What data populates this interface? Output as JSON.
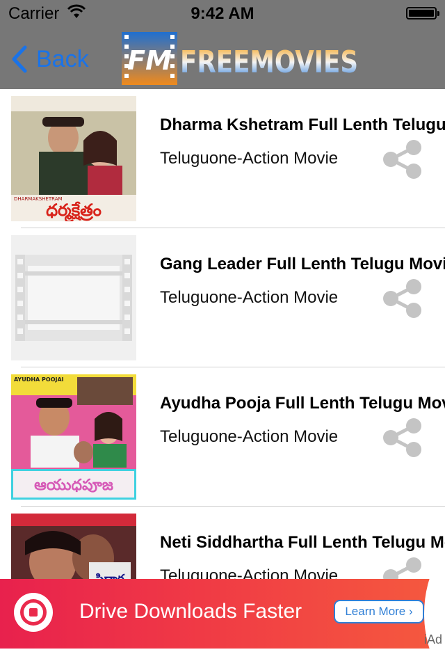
{
  "status_bar": {
    "carrier": "Carrier",
    "time": "9:42 AM"
  },
  "nav": {
    "back_label": "Back",
    "logo_badge": "FM",
    "logo_text": "FREEMOVIES"
  },
  "movies": [
    {
      "title": "Dharma Kshetram Full Lenth Telugu Movie",
      "subtitle": "Teluguone-Action Movie",
      "poster_caption": "DHARMAKSHETRAM",
      "poster_title": "ధర్మక్షేత్రం"
    },
    {
      "title": "Gang Leader Full Lenth Telugu Movie",
      "subtitle": "Teluguone-Action Movie"
    },
    {
      "title": "Ayudha Pooja Full Lenth Telugu Movie",
      "subtitle": "Teluguone-Action Movie",
      "poster_caption": "AYUDHA POOJAI",
      "poster_title": "ఆయుధపూజ"
    },
    {
      "title": "Neti Siddhartha Full Lenth Telugu Movie",
      "subtitle": "Teluguone-Action Movie",
      "poster_title": "సిద్ధార్థ"
    }
  ],
  "ad": {
    "text": "Drive Downloads Faster",
    "button_label": "Learn More ›",
    "label": "iAd"
  },
  "colors": {
    "nav_background": "#777777",
    "back_blue": "#1a73e8",
    "share_gray": "#c4c4c4",
    "ad_red": "#e8214d",
    "learn_more_blue": "#2f7fd6"
  }
}
